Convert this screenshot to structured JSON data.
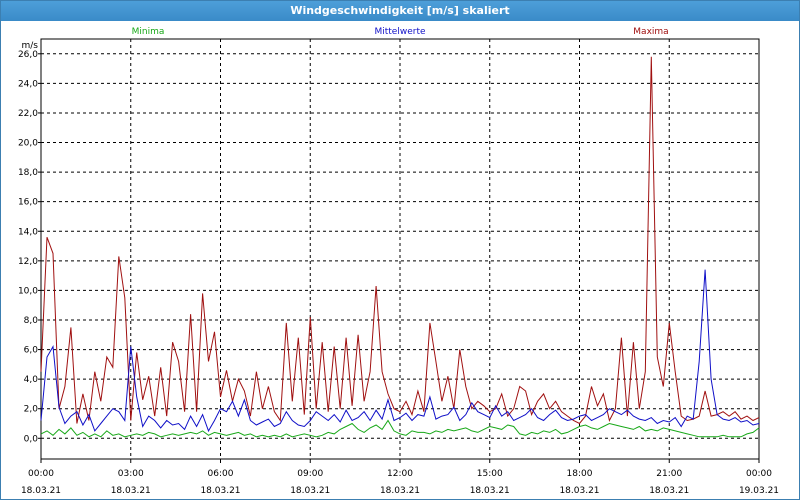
{
  "window": {
    "title": "Windgeschwindigkeit [m/s] skaliert"
  },
  "colors": {
    "minima": "#18a818",
    "mittelwerte": "#1010c8",
    "maxima": "#a01010",
    "grid": "#000000",
    "title_bg": "#3a8bc8"
  },
  "chart_data": {
    "type": "line",
    "title": "Windgeschwindigkeit [m/s] skaliert",
    "ylabel": "m/s",
    "xlabel": "",
    "ylim": [
      -1.4,
      27
    ],
    "yticks": [
      "0,0",
      "2,0",
      "4,0",
      "6,0",
      "8,0",
      "10,0",
      "12,0",
      "14,0",
      "16,0",
      "18,0",
      "20,0",
      "22,0",
      "24,0",
      "26,0"
    ],
    "ytick_values": [
      0,
      2,
      4,
      6,
      8,
      10,
      12,
      14,
      16,
      18,
      20,
      22,
      24,
      26
    ],
    "xticks": [
      {
        "time": "00:00",
        "date": "18.03.21"
      },
      {
        "time": "03:00",
        "date": "18.03.21"
      },
      {
        "time": "06:00",
        "date": "18.03.21"
      },
      {
        "time": "09:00",
        "date": "18.03.21"
      },
      {
        "time": "12:00",
        "date": "18.03.21"
      },
      {
        "time": "15:00",
        "date": "18.03.21"
      },
      {
        "time": "18:00",
        "date": "18.03.21"
      },
      {
        "time": "21:00",
        "date": "18.03.21"
      },
      {
        "time": "00:00",
        "date": "19.03.21"
      }
    ],
    "grid": true,
    "series": [
      {
        "name": "Minima",
        "x": [
          0,
          0.2,
          0.4,
          0.6,
          0.8,
          1.0,
          1.2,
          1.4,
          1.6,
          1.8,
          2.0,
          2.2,
          2.4,
          2.6,
          2.8,
          3.0,
          3.2,
          3.4,
          3.6,
          3.8,
          4.0,
          4.2,
          4.4,
          4.6,
          4.8,
          5.0,
          5.2,
          5.4,
          5.6,
          5.8,
          6.0,
          6.2,
          6.4,
          6.6,
          6.8,
          7.0,
          7.2,
          7.4,
          7.6,
          7.8,
          8.0,
          8.2,
          8.4,
          8.6,
          8.8,
          9.0,
          9.2,
          9.4,
          9.6,
          9.8,
          10.0,
          10.2,
          10.4,
          10.6,
          10.8,
          11.0,
          11.2,
          11.4,
          11.6,
          11.8,
          12.0,
          12.2,
          12.4,
          12.6,
          12.8,
          13.0,
          13.2,
          13.4,
          13.6,
          13.8,
          14.0,
          14.2,
          14.4,
          14.6,
          14.8,
          15.0,
          15.2,
          15.4,
          15.6,
          15.8,
          16.0,
          16.2,
          16.4,
          16.6,
          16.8,
          17.0,
          17.2,
          17.4,
          17.6,
          17.8,
          18.0,
          18.2,
          18.4,
          18.6,
          18.8,
          19.0,
          19.2,
          19.4,
          19.6,
          19.8,
          20.0,
          20.2,
          20.4,
          20.6,
          20.8,
          21.0,
          21.2,
          21.4,
          21.6,
          21.8,
          22.0,
          22.2,
          22.4,
          22.6,
          22.8,
          23.0,
          23.2,
          23.4,
          23.6,
          23.8,
          24.0
        ],
        "values": [
          0.3,
          0.5,
          0.2,
          0.6,
          0.3,
          0.7,
          0.2,
          0.4,
          0.1,
          0.3,
          0.1,
          0.5,
          0.2,
          0.3,
          0.1,
          0.2,
          0.3,
          0.2,
          0.4,
          0.3,
          0.1,
          0.2,
          0.3,
          0.2,
          0.3,
          0.4,
          0.3,
          0.5,
          0.2,
          0.4,
          0.3,
          0.2,
          0.3,
          0.4,
          0.2,
          0.3,
          0.1,
          0.2,
          0.1,
          0.2,
          0.1,
          0.3,
          0.1,
          0.2,
          0.3,
          0.2,
          0.1,
          0.2,
          0.4,
          0.3,
          0.6,
          0.8,
          1.0,
          0.6,
          0.4,
          0.7,
          0.9,
          0.6,
          1.2,
          0.5,
          0.3,
          0.2,
          0.5,
          0.4,
          0.4,
          0.3,
          0.5,
          0.4,
          0.6,
          0.5,
          0.6,
          0.7,
          0.5,
          0.4,
          0.6,
          0.8,
          0.7,
          0.6,
          0.9,
          0.8,
          0.3,
          0.2,
          0.4,
          0.3,
          0.5,
          0.4,
          0.6,
          0.3,
          0.4,
          0.6,
          0.8,
          0.9,
          0.7,
          0.6,
          0.8,
          1.0,
          0.9,
          0.8,
          0.7,
          0.6,
          0.8,
          0.5,
          0.6,
          0.5,
          0.7,
          0.6,
          0.5,
          0.4,
          0.3,
          0.2,
          0.1,
          0.1,
          0.1,
          0.1,
          0.2,
          0.1,
          0.1,
          0.1,
          0.3,
          0.4,
          0.7
        ]
      },
      {
        "name": "Mittelwerte",
        "x": [
          0,
          0.2,
          0.4,
          0.6,
          0.8,
          1.0,
          1.2,
          1.4,
          1.6,
          1.8,
          2.0,
          2.2,
          2.4,
          2.6,
          2.8,
          3.0,
          3.2,
          3.4,
          3.6,
          3.8,
          4.0,
          4.2,
          4.4,
          4.6,
          4.8,
          5.0,
          5.2,
          5.4,
          5.6,
          5.8,
          6.0,
          6.2,
          6.4,
          6.6,
          6.8,
          7.0,
          7.2,
          7.4,
          7.6,
          7.8,
          8.0,
          8.2,
          8.4,
          8.6,
          8.8,
          9.0,
          9.2,
          9.4,
          9.6,
          9.8,
          10.0,
          10.2,
          10.4,
          10.6,
          10.8,
          11.0,
          11.2,
          11.4,
          11.6,
          11.8,
          12.0,
          12.2,
          12.4,
          12.6,
          12.8,
          13.0,
          13.2,
          13.4,
          13.6,
          13.8,
          14.0,
          14.2,
          14.4,
          14.6,
          14.8,
          15.0,
          15.2,
          15.4,
          15.6,
          15.8,
          16.0,
          16.2,
          16.4,
          16.6,
          16.8,
          17.0,
          17.2,
          17.4,
          17.6,
          17.8,
          18.0,
          18.2,
          18.4,
          18.6,
          18.8,
          19.0,
          19.2,
          19.4,
          19.6,
          19.8,
          20.0,
          20.2,
          20.4,
          20.6,
          20.8,
          21.0,
          21.2,
          21.4,
          21.6,
          21.8,
          22.0,
          22.2,
          22.4,
          22.6,
          22.8,
          23.0,
          23.2,
          23.4,
          23.6,
          23.8,
          24.0
        ],
        "values": [
          1.2,
          5.5,
          6.2,
          2.1,
          1.0,
          1.5,
          1.8,
          0.9,
          1.6,
          0.5,
          1.0,
          1.5,
          2.0,
          1.8,
          1.2,
          6.2,
          2.8,
          0.8,
          1.5,
          1.2,
          0.7,
          1.2,
          0.9,
          1.0,
          0.6,
          1.5,
          0.8,
          1.6,
          0.5,
          1.2,
          2.0,
          1.8,
          2.5,
          1.5,
          2.6,
          1.2,
          0.9,
          1.1,
          1.3,
          0.8,
          1.0,
          1.8,
          1.2,
          0.9,
          0.8,
          1.2,
          1.8,
          1.5,
          1.2,
          1.6,
          1.1,
          1.9,
          1.2,
          1.4,
          1.8,
          1.2,
          1.9,
          1.3,
          2.6,
          1.2,
          1.4,
          1.7,
          1.2,
          1.6,
          1.5,
          2.8,
          1.3,
          1.5,
          1.6,
          2.1,
          1.2,
          1.6,
          2.4,
          1.8,
          1.6,
          1.4,
          2.2,
          1.5,
          1.8,
          1.2,
          1.4,
          1.6,
          2.0,
          1.4,
          1.2,
          1.6,
          1.9,
          1.4,
          1.2,
          1.3,
          1.5,
          1.6,
          1.2,
          1.4,
          1.6,
          2.0,
          1.8,
          1.6,
          1.9,
          1.5,
          1.3,
          1.2,
          1.4,
          1.0,
          1.2,
          1.1,
          1.4,
          0.8,
          1.5,
          1.3,
          5.2,
          11.4,
          4.0,
          1.6,
          1.3,
          1.2,
          1.4,
          1.1,
          1.2,
          0.9,
          1.0
        ]
      },
      {
        "name": "Maxima",
        "x": [
          0,
          0.2,
          0.4,
          0.6,
          0.8,
          1.0,
          1.2,
          1.4,
          1.6,
          1.8,
          2.0,
          2.2,
          2.4,
          2.6,
          2.8,
          3.0,
          3.2,
          3.4,
          3.6,
          3.8,
          4.0,
          4.2,
          4.4,
          4.6,
          4.8,
          5.0,
          5.2,
          5.4,
          5.6,
          5.8,
          6.0,
          6.2,
          6.4,
          6.6,
          6.8,
          7.0,
          7.2,
          7.4,
          7.6,
          7.8,
          8.0,
          8.2,
          8.4,
          8.6,
          8.8,
          9.0,
          9.2,
          9.4,
          9.6,
          9.8,
          10.0,
          10.2,
          10.4,
          10.6,
          10.8,
          11.0,
          11.2,
          11.4,
          11.6,
          11.8,
          12.0,
          12.2,
          12.4,
          12.6,
          12.8,
          13.0,
          13.2,
          13.4,
          13.6,
          13.8,
          14.0,
          14.2,
          14.4,
          14.6,
          14.8,
          15.0,
          15.2,
          15.4,
          15.6,
          15.8,
          16.0,
          16.2,
          16.4,
          16.6,
          16.8,
          17.0,
          17.2,
          17.4,
          17.6,
          17.8,
          18.0,
          18.2,
          18.4,
          18.6,
          18.8,
          19.0,
          19.2,
          19.4,
          19.6,
          19.8,
          20.0,
          20.2,
          20.4,
          20.6,
          20.8,
          21.0,
          21.2,
          21.4,
          21.6,
          21.8,
          22.0,
          22.2,
          22.4,
          22.6,
          22.8,
          23.0,
          23.2,
          23.4,
          23.6,
          23.8,
          24.0
        ],
        "values": [
          4.5,
          13.6,
          12.5,
          2.0,
          3.5,
          7.5,
          1.0,
          3.0,
          1.2,
          4.5,
          2.5,
          5.5,
          4.8,
          12.3,
          9.5,
          1.2,
          5.8,
          2.6,
          4.2,
          1.5,
          4.8,
          1.5,
          6.5,
          5.2,
          1.8,
          8.4,
          1.8,
          9.8,
          5.2,
          7.2,
          2.8,
          4.6,
          2.5,
          4.0,
          3.2,
          1.5,
          4.5,
          2.0,
          3.5,
          1.8,
          1.2,
          7.8,
          2.5,
          6.8,
          1.6,
          8.2,
          2.0,
          6.5,
          1.8,
          6.2,
          2.0,
          6.8,
          2.2,
          7.0,
          2.5,
          4.5,
          10.3,
          4.5,
          3.0,
          2.0,
          1.8,
          2.5,
          1.6,
          3.2,
          1.8,
          7.8,
          5.2,
          2.5,
          4.2,
          2.0,
          6.0,
          3.5,
          2.0,
          2.5,
          2.2,
          1.8,
          2.0,
          3.0,
          1.5,
          2.0,
          3.5,
          3.2,
          1.6,
          2.5,
          3.0,
          2.0,
          2.5,
          1.8,
          1.5,
          1.2,
          1.0,
          1.5,
          3.5,
          2.2,
          3.0,
          1.2,
          2.0,
          6.8,
          1.5,
          6.5,
          2.0,
          4.5,
          25.8,
          5.5,
          3.5,
          7.8,
          4.5,
          1.5,
          1.2,
          1.3,
          1.5,
          3.2,
          1.5,
          1.6,
          1.8,
          1.5,
          1.8,
          1.3,
          1.5,
          1.2,
          1.4
        ]
      }
    ]
  }
}
